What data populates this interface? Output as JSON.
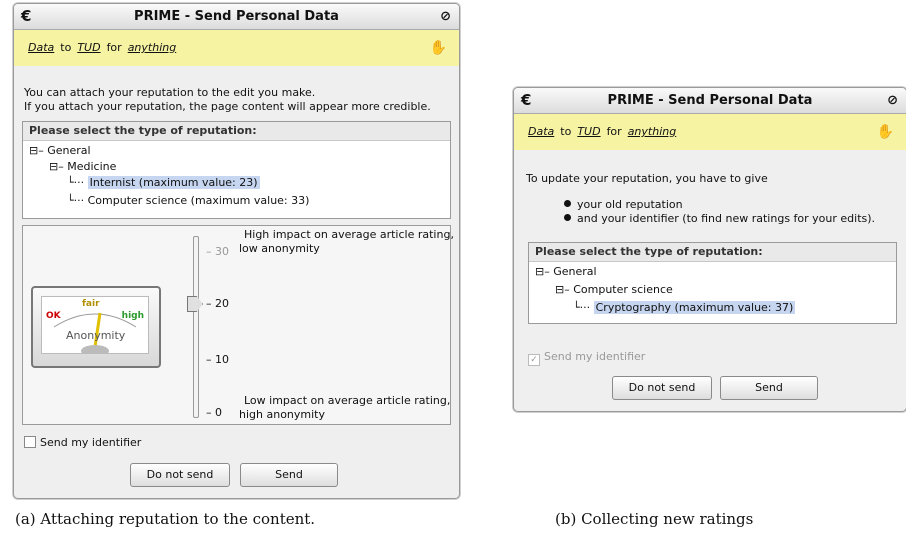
{
  "dialog_a": {
    "title": "PRIME - Send Personal Data",
    "banner": {
      "data": "Data",
      "to": "to",
      "target": "TUD",
      "for": "for",
      "purpose": "anything"
    },
    "intro_line1": "You can attach your reputation to the edit you make.",
    "intro_line2": "If you attach your reputation, the page content will appear more credible.",
    "panel_header": "Please select the type of reputation:",
    "tree": {
      "root": "General",
      "child": "Medicine",
      "selected": "Internist (maximum value: 23)",
      "other": "Computer science (maximum value: 33)"
    },
    "gauge": {
      "ok": "OK",
      "fair": "fair",
      "high": "high",
      "label": "Anonymity",
      "needle_level": "fair"
    },
    "slider": {
      "top_note_line1": "High impact on average article rating,",
      "top_note_line2": "low anonymity",
      "bottom_note_line1": "Low impact on average article rating,",
      "bottom_note_line2": "high anonymity",
      "ticks": [
        "30",
        "20",
        "10",
        "0"
      ],
      "value": 20
    },
    "checkbox_label": "Send my identifier",
    "checkbox_checked": false,
    "btn_cancel": "Do not send",
    "btn_send": "Send",
    "caption": "(a) Attaching reputation to the content."
  },
  "dialog_b": {
    "title": "PRIME - Send Personal Data",
    "banner": {
      "data": "Data",
      "to": "to",
      "target": "TUD",
      "for": "for",
      "purpose": "anything"
    },
    "intro": "To update your reputation, you have to give",
    "bullet1": "your old reputation",
    "bullet2": "and your identifier (to find new ratings for your edits).",
    "panel_header": "Please select the type of reputation:",
    "tree": {
      "root": "General",
      "child": "Computer science",
      "selected": "Cryptography (maximum value: 37)"
    },
    "checkbox_label": "Send my identifier",
    "checkbox_checked": true,
    "btn_cancel": "Do not send",
    "btn_send": "Send",
    "caption": "(b) Collecting new ratings"
  },
  "colors": {
    "banner": "#f6f3a3",
    "selection": "#c6d6f0",
    "gauge_needle": "#e0c000",
    "ok": "#cc0000",
    "high": "#2a9a2a"
  },
  "icons": {
    "title_left": "c-logo-icon",
    "title_right": "close-icon",
    "banner": "guard-icon"
  }
}
